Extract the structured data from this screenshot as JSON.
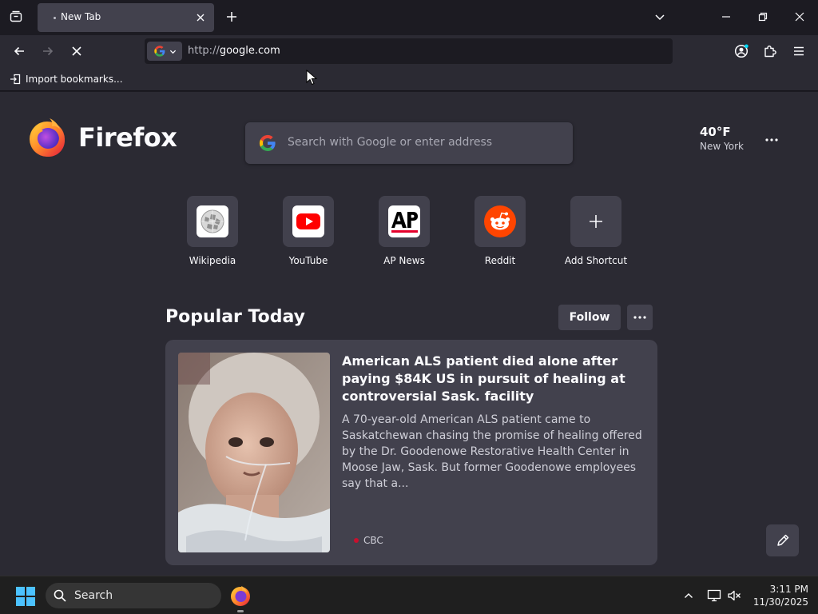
{
  "browser": {
    "tab": {
      "title": "New Tab"
    },
    "url": {
      "protocol": "http://",
      "host": "google.com"
    },
    "bookmarks_toolbar": {
      "import_label": "Import bookmarks..."
    }
  },
  "newtab": {
    "brand": "Firefox",
    "search": {
      "placeholder": "Search with Google or enter address"
    },
    "weather": {
      "temperature": "40°F",
      "location": "New York"
    },
    "shortcuts": [
      {
        "label": "Wikipedia",
        "icon": "wikipedia-icon"
      },
      {
        "label": "YouTube",
        "icon": "youtube-icon"
      },
      {
        "label": "AP News",
        "icon": "ap-news-icon"
      },
      {
        "label": "Reddit",
        "icon": "reddit-icon"
      },
      {
        "label": "Add Shortcut",
        "icon": "plus-icon"
      }
    ],
    "popular": {
      "heading": "Popular Today",
      "follow_label": "Follow",
      "story": {
        "title": "American ALS patient died alone after paying $84K US in pursuit of healing at controversial Sask. facility",
        "excerpt": "A 70-year-old American ALS patient came to Saskatchewan chasing the promise of healing offered by the Dr. Goodenowe Restorative Health Center in Moose Jaw, Sask. But former Goodenowe employees say that a...",
        "source": "CBC"
      }
    }
  },
  "taskbar": {
    "search_label": "Search",
    "time": "3:11 PM",
    "date": "11/30/2025"
  },
  "colors": {
    "chrome_dark": "#1c1b22",
    "toolbar": "#2b2a33",
    "surface": "#42414d",
    "youtube_red": "#ff0000",
    "reddit_orange": "#ff4500",
    "cbc_red": "#c8102e"
  }
}
